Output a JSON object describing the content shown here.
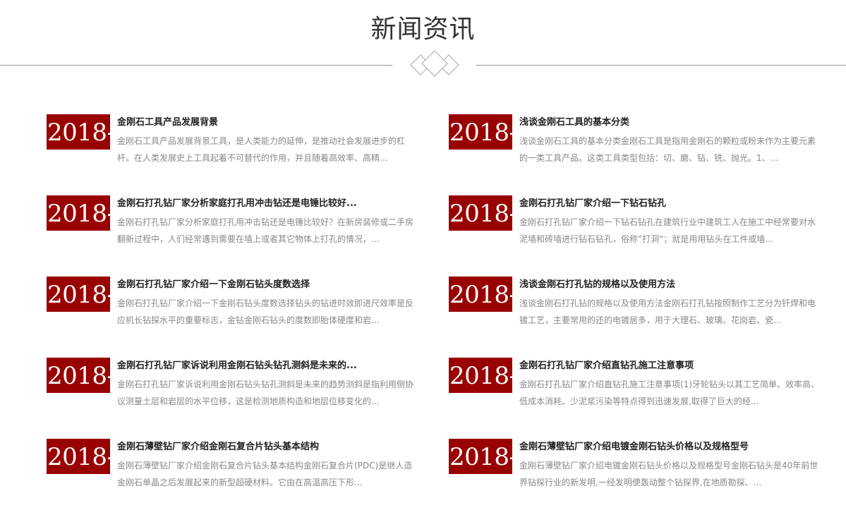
{
  "section": {
    "title": "新闻资讯",
    "ornament_icon": "diamond-ornament-icon"
  },
  "colors": {
    "date_bg": "#990000",
    "title_text": "#222222",
    "summary_text": "#888888",
    "divider": "#9a9a9a"
  },
  "news": [
    {
      "date": "2018-",
      "title": "金刚石工具产品发展背景",
      "summary": "金刚石工具产品发展背景工具，是人类能力的延伸，是推动社会发展进步的杠杆。在人类发展史上工具起着不可替代的作用，并且随着高效率、高精..."
    },
    {
      "date": "2018-",
      "title": "浅谈金刚石工具的基本分类",
      "summary": "浅谈金刚石工具的基本分类金刚石工具是指用金刚石的颗粒或粉末作为主要元素的一类工具产品。这类工具类型包括：切、磨、钻、铣、抛光。1、..."
    },
    {
      "date": "2018-",
      "title": "金刚石打孔钻厂家分析家庭打孔用冲击钻还是电锤比较好...",
      "summary": "金刚石打孔钻厂家分析家庭打孔用冲击钻还是电锤比较好？在新房装修或二手房翻新过程中，人们经常遇到需要在墙上或者其它物体上打孔的情况，..."
    },
    {
      "date": "2018-",
      "title": "金刚石打孔钻厂家介绍一下钻石钻孔",
      "summary": "金刚石打孔钻厂家介绍一下钻石钻孔在建筑行业中建筑工人在施工中经常要对水泥墙和砖墙进行钻石钻孔，俗称”打洞“；就是用用钻头在工件或墙..."
    },
    {
      "date": "2018-",
      "title": "金刚石打孔钻厂家介绍一下金刚石钻头度数选择",
      "summary": "金刚石打孔钻厂家介绍一下金刚石钻头度数选择钻头的钻进时效即进尺效率是反应机长钻探水平的重要标志，金钻金刚石钻头的度数即胎体硬度和岩..."
    },
    {
      "date": "2018-",
      "title": "浅谈金刚石打孔钻的规格以及使用方法",
      "summary": "浅谈金刚石打孔钻的规格以及使用方法金刚石打孔钻按照制作工艺分为钎焊和电镀工艺，主要常用的还的电镀居多，用于大理石、玻璃、花岗岩、瓷..."
    },
    {
      "date": "2018-",
      "title": "金刚石打孔钻厂家诉说利用金刚石钻头钻孔测斜是未来的...",
      "summary": "金刚石打孔钻厂家诉说利用金刚石钻头钻孔测斜是未来的趋势测斜是指利用侧协议测量土层和岩层的水平位移，这是检测地质构造和地层位移变化的..."
    },
    {
      "date": "2018-",
      "title": "金刚石打孔钻厂家介绍直钻孔施工注意事项",
      "summary": "金刚石打孔钻厂家介绍直钻孔施工注意事项(1)牙轮钻头以其工艺简单、效率高、低成本消耗、少泥浆污染等特点得到迅速发展,取得了巨大的经..."
    },
    {
      "date": "2018-",
      "title": "金刚石薄壁钻厂家介绍金刚石复合片钻头基本结构",
      "summary": "金刚石薄壁钻厂家介绍金刚石复合片钻头基本结构金刚石复合片(PDC)是继人造金刚石单晶之后发展起来的新型超硬材料。它由在高温高压下形..."
    },
    {
      "date": "2018-",
      "title": "金刚石薄壁钻厂家介绍电镀金刚石钻头价格以及规格型号",
      "summary": "金刚石薄壁钻厂家介绍电镀金刚石钻头价格以及规格型号金刚石钻头是40年前世界钻探行业的新发明,一经发明便轰动整个钻探界,在地质勘探、..."
    }
  ]
}
